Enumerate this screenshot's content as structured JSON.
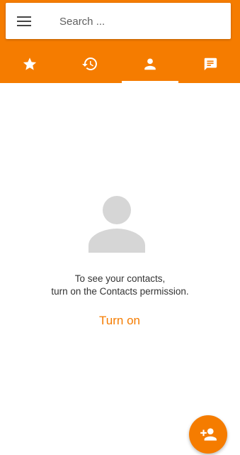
{
  "colors": {
    "brand": "#f57c00",
    "icon_on_brand": "#ffffff",
    "placeholder_gray": "#d6d6d6",
    "text": "#333333"
  },
  "search": {
    "placeholder": "Search ...",
    "value": "",
    "menu_icon": "menu-icon"
  },
  "tabs": [
    {
      "id": "favorites",
      "icon": "star-icon",
      "selected": false
    },
    {
      "id": "recents",
      "icon": "history-icon",
      "selected": false
    },
    {
      "id": "contacts",
      "icon": "person-icon",
      "selected": true
    },
    {
      "id": "voicemail",
      "icon": "message-icon",
      "selected": false
    }
  ],
  "empty_state": {
    "icon": "person-placeholder-icon",
    "line1": "To see your contacts,",
    "line2": "turn on the Contacts permission.",
    "action_label": "Turn on"
  },
  "fab": {
    "icon": "add-contact-icon"
  }
}
